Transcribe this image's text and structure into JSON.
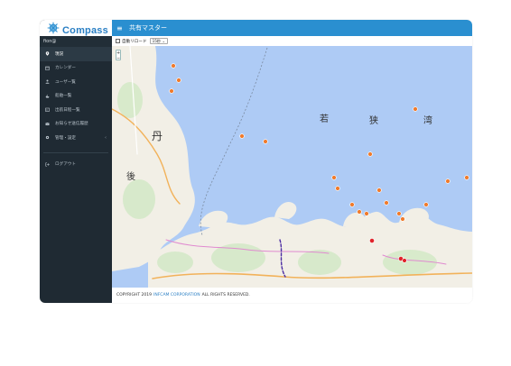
{
  "brand": {
    "top": "marine",
    "main": "Compass"
  },
  "user": {
    "name": "fion@"
  },
  "nav": {
    "items": [
      {
        "label": "現況",
        "icon": "location-pin-icon"
      },
      {
        "label": "カレンダー",
        "icon": "calendar-icon"
      },
      {
        "label": "ユーザー覧",
        "icon": "user-icon"
      },
      {
        "label": "船舶一覧",
        "icon": "boat-icon"
      },
      {
        "label": "出航日程一覧",
        "icon": "schedule-icon"
      },
      {
        "label": "お知らせ送信履歴",
        "icon": "mail-history-icon"
      },
      {
        "label": "管理・設定",
        "icon": "gear-icon"
      }
    ],
    "logout": {
      "label": "ログアウト",
      "icon": "logout-icon"
    }
  },
  "topbar": {
    "menu_icon": "menu-icon",
    "title": "共有マスター"
  },
  "toolbar": {
    "auto_reload_label": "自動リロード",
    "interval_value": "15秒"
  },
  "map": {
    "labels": {
      "bay1": "若",
      "bay2": "狭",
      "bay3": "湾",
      "tan": "丹",
      "go": "後"
    }
  },
  "footer": {
    "copyright": "COPYRIGHT 2019",
    "company": "INFCAM CORPORATION",
    "rights": "ALL RIGHTS RESERVED."
  },
  "colors": {
    "topbar": "#2a8fd0",
    "sidebar": "#1f2a33",
    "sea": "#aecbf5",
    "land": "#f2efe6",
    "pin_normal": "#f07b2c",
    "pin_alert": "#e0232a"
  }
}
